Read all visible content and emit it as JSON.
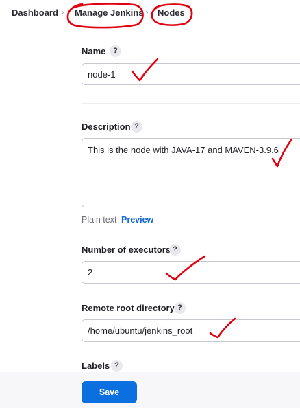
{
  "breadcrumb": {
    "items": [
      "Dashboard",
      "Manage Jenkins",
      "Nodes"
    ],
    "separator": "›"
  },
  "form": {
    "name": {
      "label": "Name",
      "value": "node-1"
    },
    "description": {
      "label": "Description",
      "value": "This is the node with JAVA-17 and MAVEN-3.9.6",
      "plain_text": "Plain text",
      "preview": "Preview"
    },
    "executors": {
      "label": "Number of executors",
      "value": "2"
    },
    "remote_root": {
      "label": "Remote root directory",
      "value": "/home/ubuntu/jenkins_root"
    },
    "labels": {
      "label": "Labels"
    },
    "help_glyph": "?",
    "save_label": "Save"
  },
  "colors": {
    "annotation": "#e0000f",
    "primary": "#0b6fe0",
    "link": "#1268d8"
  },
  "icons": {
    "help": "question-circle-icon",
    "annotation": "red-pen-markup"
  }
}
